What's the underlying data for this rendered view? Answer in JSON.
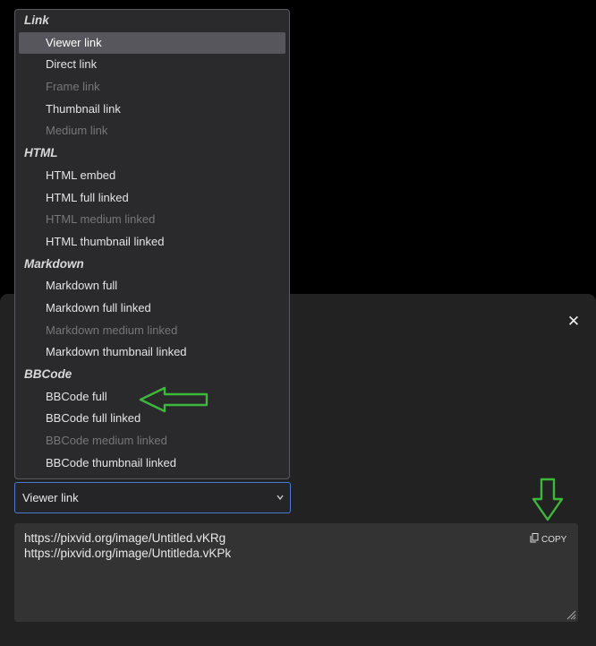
{
  "dropdown": {
    "groups": [
      {
        "label": "Link",
        "options": [
          {
            "label": "Viewer link",
            "state": "selected"
          },
          {
            "label": "Direct link",
            "state": "enabled"
          },
          {
            "label": "Frame link",
            "state": "disabled"
          },
          {
            "label": "Thumbnail link",
            "state": "enabled"
          },
          {
            "label": "Medium link",
            "state": "disabled"
          }
        ]
      },
      {
        "label": "HTML",
        "options": [
          {
            "label": "HTML embed",
            "state": "enabled"
          },
          {
            "label": "HTML full linked",
            "state": "enabled"
          },
          {
            "label": "HTML medium linked",
            "state": "disabled"
          },
          {
            "label": "HTML thumbnail linked",
            "state": "enabled"
          }
        ]
      },
      {
        "label": "Markdown",
        "options": [
          {
            "label": "Markdown full",
            "state": "enabled"
          },
          {
            "label": "Markdown full linked",
            "state": "enabled"
          },
          {
            "label": "Markdown medium linked",
            "state": "disabled"
          },
          {
            "label": "Markdown thumbnail linked",
            "state": "enabled"
          }
        ]
      },
      {
        "label": "BBCode",
        "options": [
          {
            "label": "BBCode full",
            "state": "enabled"
          },
          {
            "label": "BBCode full linked",
            "state": "enabled"
          },
          {
            "label": "BBCode medium linked",
            "state": "disabled"
          },
          {
            "label": "BBCode thumbnail linked",
            "state": "enabled"
          }
        ]
      }
    ]
  },
  "select": {
    "value": "Viewer link"
  },
  "embed_codes": {
    "lines": [
      "https://pixvid.org/image/Untitled.vKRg",
      "https://pixvid.org/image/Untitleda.vKPk"
    ],
    "copy_label": "COPY"
  },
  "modal": {
    "close_glyph": "✕"
  },
  "colors": {
    "annotation_arrow": "#3db83d",
    "focus_border": "#4a7bd1"
  }
}
